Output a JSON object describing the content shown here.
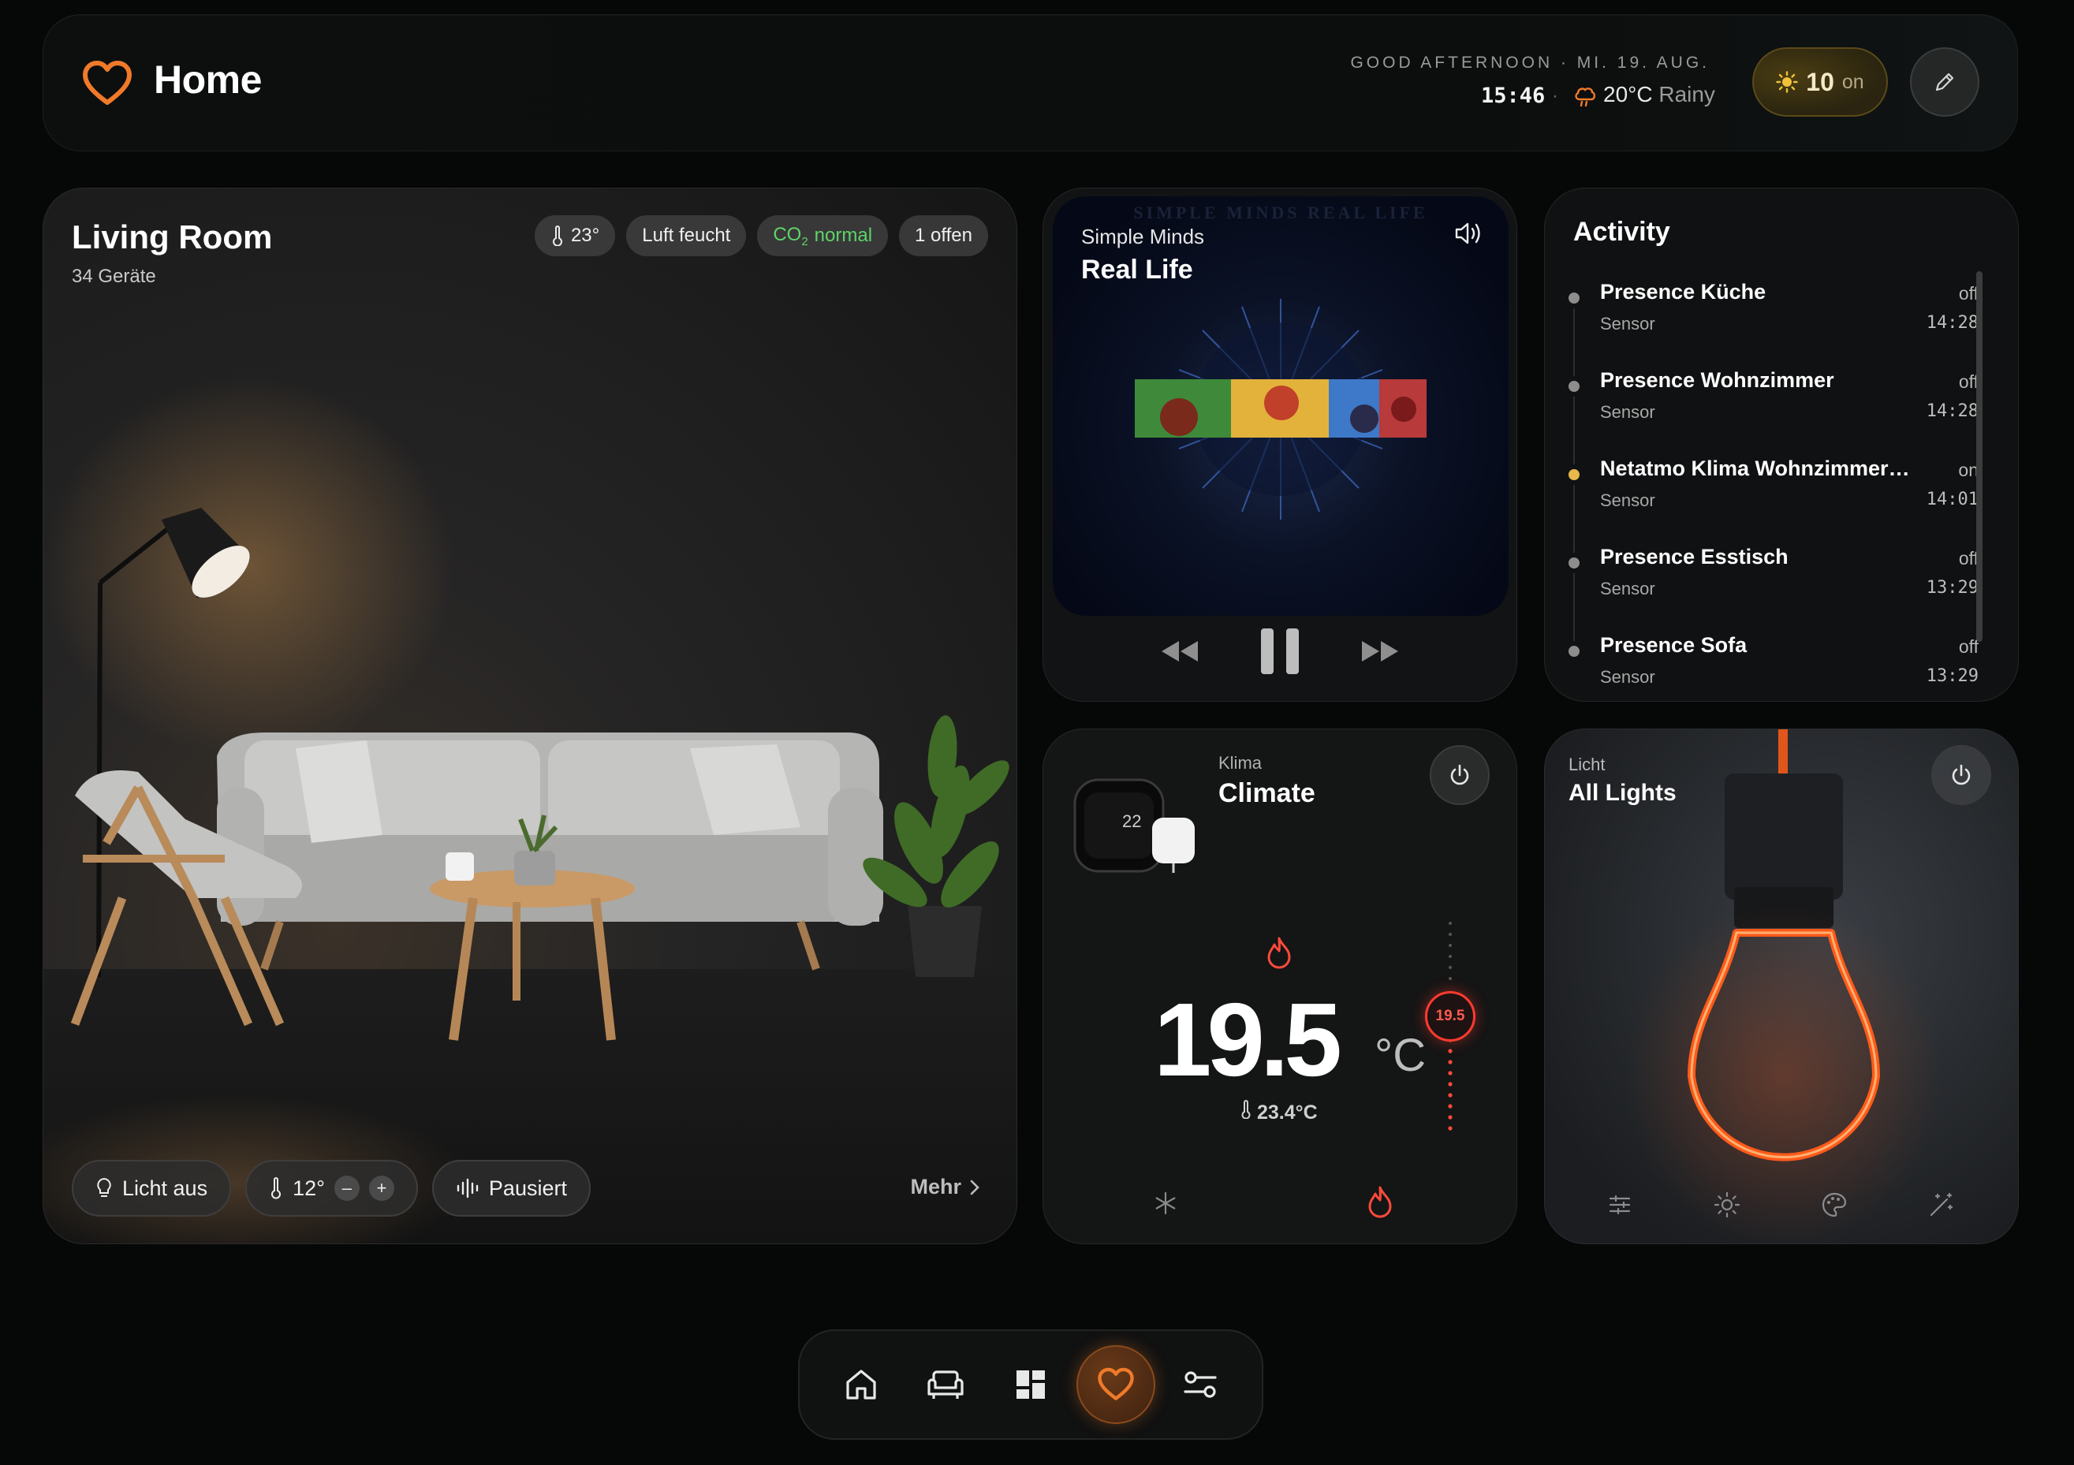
{
  "header": {
    "title": "Home",
    "greeting": "GOOD AFTERNOON · MI. 19. AUG.",
    "time": "15:46",
    "separator": "·",
    "temperature": "20°C",
    "condition": "Rainy",
    "on_count": "10",
    "on_label": "on",
    "accent": "#f07a2a"
  },
  "room": {
    "title": "Living Room",
    "subtitle": "34 Geräte",
    "chips": {
      "temp": "23°",
      "humidity": "Luft feucht",
      "co2_prefix": "CO",
      "co2_sub": "2",
      "co2_status": "normal",
      "open": "1 offen"
    },
    "light_button": "Licht aus",
    "thermostat_value": "12°",
    "minus": "–",
    "plus": "+",
    "media_status": "Pausiert",
    "more": "Mehr"
  },
  "media": {
    "artist": "Simple Minds",
    "track": "Real Life",
    "album_text": "SIMPLE MINDS REAL LIFE"
  },
  "activity": {
    "title": "Activity",
    "items": [
      {
        "name": "Presence Küche",
        "kind": "Sensor",
        "state": "off",
        "time": "14:28",
        "on": false
      },
      {
        "name": "Presence Wohnzimmer",
        "kind": "Sensor",
        "state": "off",
        "time": "14:28",
        "on": false
      },
      {
        "name": "Netatmo Klima Wohnzimmer Ko...",
        "kind": "Sensor",
        "state": "on",
        "time": "14:01",
        "on": true
      },
      {
        "name": "Presence Esstisch",
        "kind": "Sensor",
        "state": "off",
        "time": "13:29",
        "on": false
      },
      {
        "name": "Presence Sofa",
        "kind": "Sensor",
        "state": "off",
        "time": "13:29",
        "on": false
      }
    ]
  },
  "climate": {
    "label": "Klima",
    "title": "Climate",
    "target": "19.5",
    "unit": "°C",
    "current": "23.4°C",
    "thermostat_display": "22",
    "heat_color": "#ff4a3a"
  },
  "lights": {
    "label": "Licht",
    "title": "All Lights",
    "glow_color": "#ff4a1a"
  },
  "dock": {
    "items": [
      "home-icon",
      "sofa-icon",
      "dashboard-icon",
      "heart-icon",
      "sliders-icon"
    ],
    "active": "heart-icon"
  }
}
